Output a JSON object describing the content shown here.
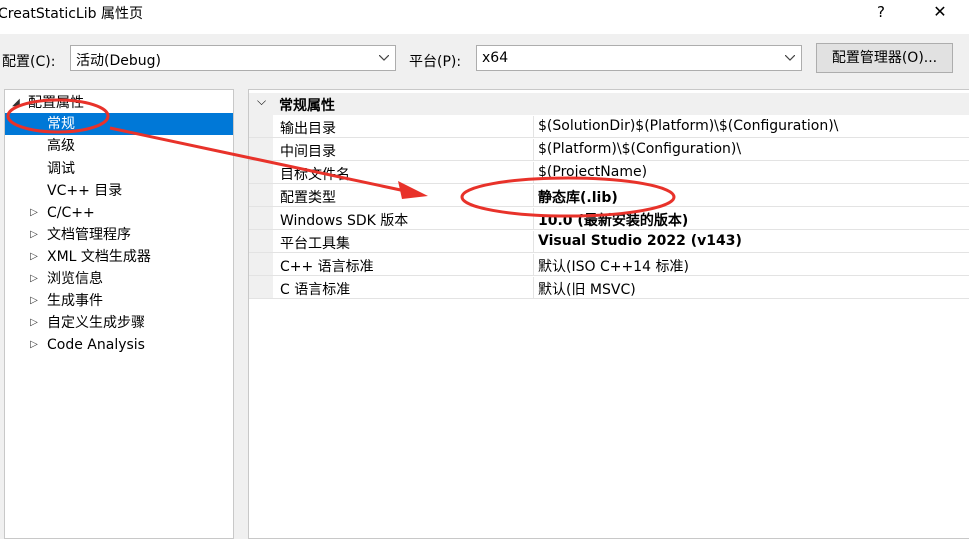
{
  "window": {
    "title": "CreatStaticLib 属性页",
    "help_label": "?",
    "close_label": "✕"
  },
  "toolbar": {
    "config_label": "配置(C):",
    "config_value": "活动(Debug)",
    "platform_label": "平台(P):",
    "platform_value": "x64",
    "manager_button": "配置管理器(O)..."
  },
  "tree": {
    "root": {
      "label": "配置属性",
      "toggle": "◢"
    },
    "children": [
      {
        "label": "常规",
        "selected": true
      },
      {
        "label": "高级"
      },
      {
        "label": "调试"
      },
      {
        "label": "VC++ 目录"
      }
    ],
    "collapsed": [
      {
        "label": "C/C++",
        "toggle": "▷"
      },
      {
        "label": "文档管理程序",
        "toggle": "▷"
      },
      {
        "label": "XML 文档生成器",
        "toggle": "▷"
      },
      {
        "label": "浏览信息",
        "toggle": "▷"
      },
      {
        "label": "生成事件",
        "toggle": "▷"
      },
      {
        "label": "自定义生成步骤",
        "toggle": "▷"
      },
      {
        "label": "Code Analysis",
        "toggle": "▷"
      }
    ]
  },
  "grid": {
    "category": {
      "label": "常规属性",
      "toggle": "⌵"
    },
    "rows": [
      {
        "name": "输出目录",
        "value": "$(SolutionDir)$(Platform)\\$(Configuration)\\"
      },
      {
        "name": "中间目录",
        "value": "$(Platform)\\$(Configuration)\\"
      },
      {
        "name": "目标文件名",
        "value": "$(ProjectName)"
      },
      {
        "name": "配置类型",
        "value": "静态库(.lib)"
      },
      {
        "name": "Windows SDK 版本",
        "value": "10.0 (最新安装的版本)"
      },
      {
        "name": "平台工具集",
        "value": "Visual Studio 2022 (v143)"
      },
      {
        "name": "C++ 语言标准",
        "value": "默认(ISO C++14 标准)"
      },
      {
        "name": "C 语言标准",
        "value": "默认(旧 MSVC)"
      }
    ]
  },
  "colors": {
    "accent": "#0078d7",
    "annotation": "#e8322a"
  }
}
